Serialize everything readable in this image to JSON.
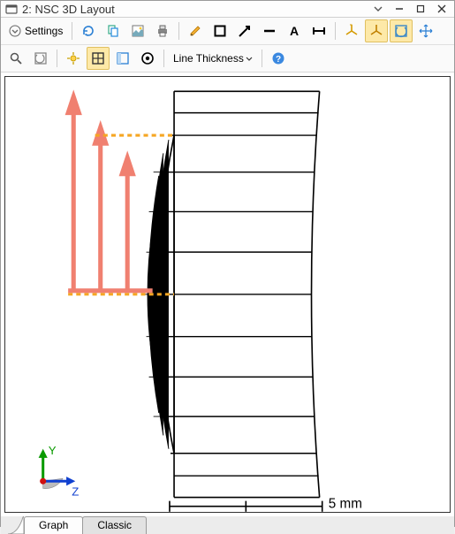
{
  "window": {
    "title": "2: NSC 3D Layout"
  },
  "toolbar1": {
    "settings_label": "Settings"
  },
  "toolbar2": {
    "line_thickness_label": "Line Thickness"
  },
  "canvas": {
    "scale_label": "5 mm",
    "axis_y": "Y",
    "axis_z": "Z"
  },
  "tabs": {
    "graph": "Graph",
    "classic": "Classic"
  }
}
